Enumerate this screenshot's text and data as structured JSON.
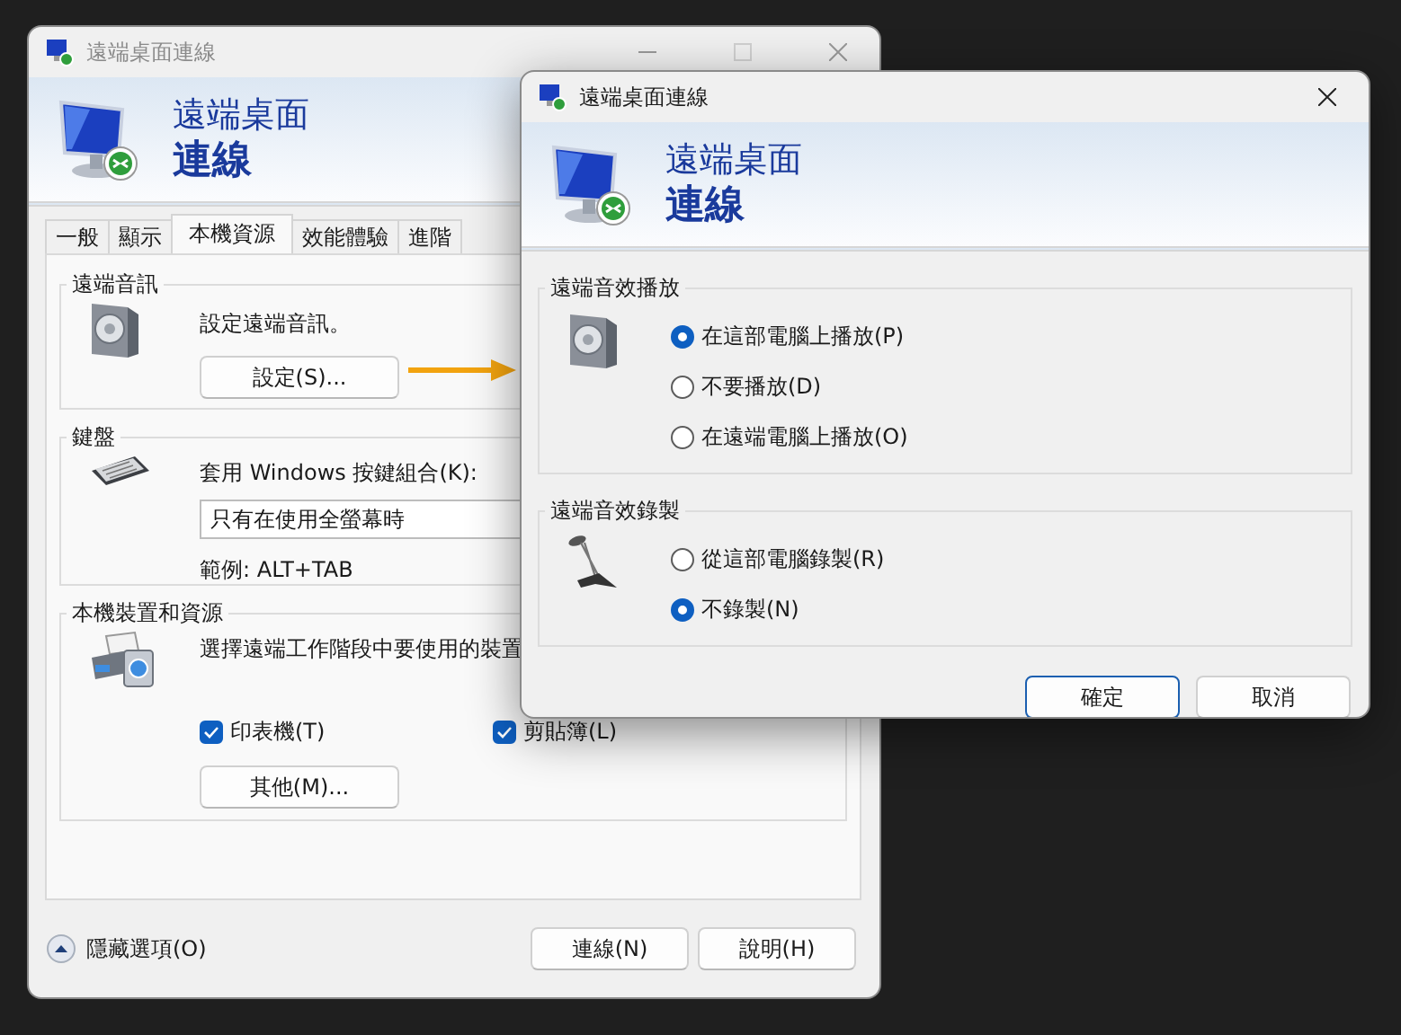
{
  "main_window": {
    "title": "遠端桌面連線",
    "active": false,
    "banner": {
      "line1": "遠端桌面",
      "line2": "連線"
    },
    "tabs": [
      {
        "label": "一般",
        "selected": false
      },
      {
        "label": "顯示",
        "selected": false
      },
      {
        "label": "本機資源",
        "selected": true
      },
      {
        "label": "效能體驗",
        "selected": false
      },
      {
        "label": "進階",
        "selected": false
      }
    ],
    "groups": [
      {
        "kind": "audio",
        "title": "遠端音訊",
        "text": "設定遠端音訊。",
        "button": "設定(S)..."
      },
      {
        "kind": "keyboard",
        "title": "鍵盤",
        "label": "套用 Windows 按鍵組合(K):",
        "select_value": "只有在使用全螢幕時",
        "example": "範例: ALT+TAB"
      },
      {
        "kind": "devices",
        "title": "本機裝置和資源",
        "text": "選擇遠端工作階段中要使用的裝置",
        "checkboxes": [
          {
            "label": "印表機(T)",
            "checked": true
          },
          {
            "label": "剪貼簿(L)",
            "checked": true
          }
        ],
        "button": "其他(M)..."
      }
    ],
    "options_toggle": "隱藏選項(O)",
    "buttons": [
      "連線(N)",
      "說明(H)"
    ]
  },
  "dialog": {
    "title": "遠端桌面連線",
    "active": true,
    "banner": {
      "line1": "遠端桌面",
      "line2": "連線"
    },
    "groups": [
      {
        "kind": "speaker",
        "title": "遠端音效播放",
        "options": [
          {
            "label": "在這部電腦上播放(P)",
            "selected": true
          },
          {
            "label": "不要播放(D)",
            "selected": false
          },
          {
            "label": "在遠端電腦上播放(O)",
            "selected": false
          }
        ]
      },
      {
        "kind": "microphone",
        "title": "遠端音效錄製",
        "options": [
          {
            "label": "從這部電腦錄製(R)",
            "selected": false
          },
          {
            "label": "不錄製(N)",
            "selected": true
          }
        ]
      }
    ],
    "buttons": [
      {
        "label": "確定",
        "default": true
      },
      {
        "label": "取消",
        "default": false
      }
    ]
  }
}
